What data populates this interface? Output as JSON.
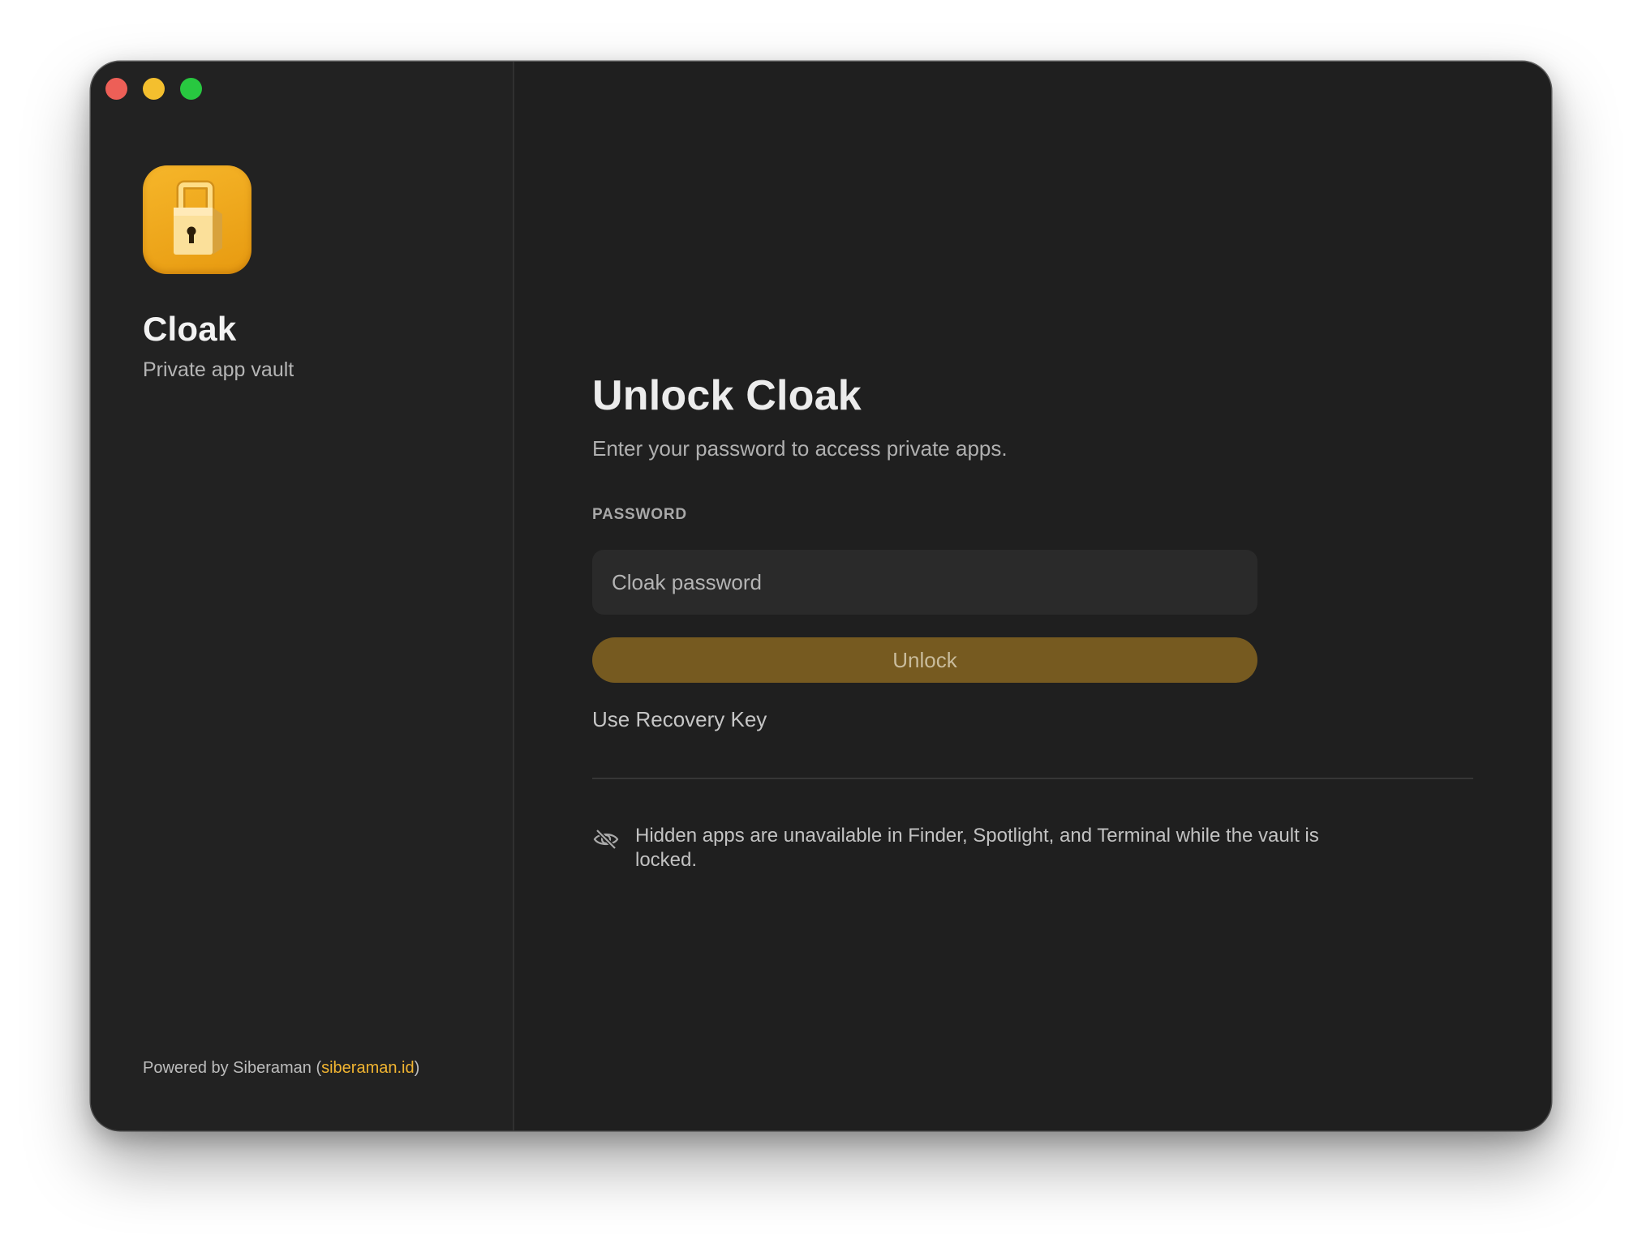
{
  "sidebar": {
    "app_name": "Cloak",
    "tagline": "Private app vault",
    "app_icon": "padlock-icon",
    "footer": {
      "prefix": "Powered by Siberaman (",
      "link": "siberaman.id",
      "suffix": ")"
    }
  },
  "main": {
    "title": "Unlock Cloak",
    "subtitle": "Enter your password to access private apps.",
    "password_label": "PASSWORD",
    "password_placeholder": "Cloak password",
    "password_value": "",
    "unlock_label": "Unlock",
    "recovery_label": "Use Recovery Key",
    "notice_icon": "eye-slash-icon",
    "notice": "Hidden apps are unavailable in Finder, Spotlight, and Terminal while the vault is locked."
  },
  "colors": {
    "accent": "#f2b531",
    "unlock_button": "#765a20",
    "window_bg": "#1f1f1f",
    "sidebar_bg": "#222222"
  }
}
